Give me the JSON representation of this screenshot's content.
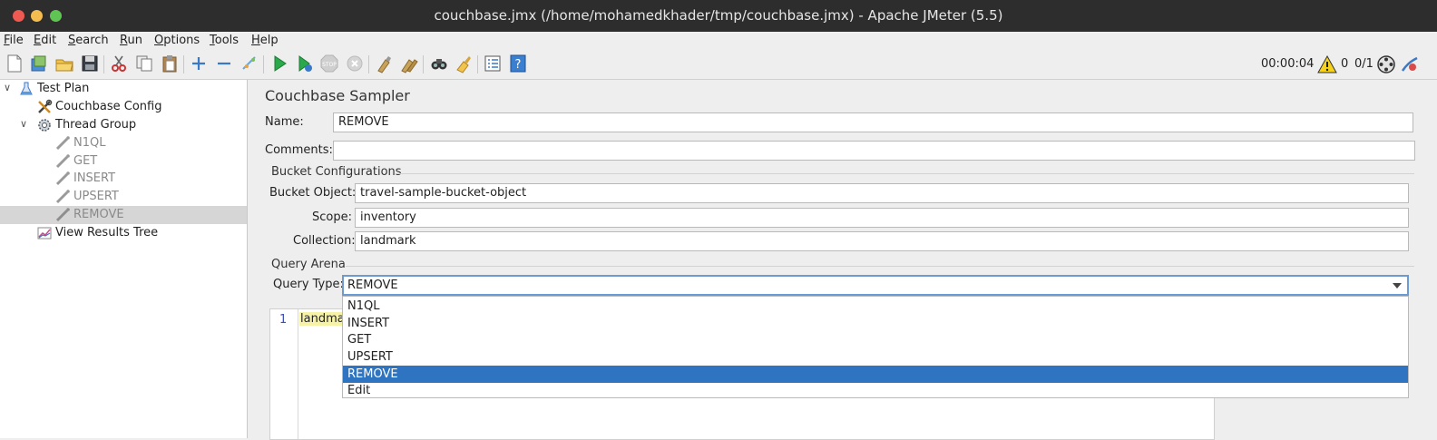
{
  "window": {
    "title": "couchbase.jmx (/home/mohamedkhader/tmp/couchbase.jmx) - Apache JMeter (5.5)",
    "traffic_lights": [
      "#ee5a52",
      "#f5bd4f",
      "#5fc454"
    ]
  },
  "menu": {
    "items": [
      {
        "mnemonic": "F",
        "rest": "ile"
      },
      {
        "mnemonic": "E",
        "rest": "dit"
      },
      {
        "mnemonic": "S",
        "rest": "earch"
      },
      {
        "mnemonic": "R",
        "rest": "un"
      },
      {
        "mnemonic": "O",
        "rest": "ptions"
      },
      {
        "mnemonic": "T",
        "rest": "ools"
      },
      {
        "mnemonic": "H",
        "rest": "elp"
      }
    ]
  },
  "toolbar": {
    "elapsed_time": "00:00:04",
    "warning_count": "0",
    "threads": "0/1"
  },
  "tree": {
    "nodes": [
      {
        "label": "Test Plan",
        "icon": "flask-icon",
        "expanded": true
      },
      {
        "label": "Couchbase Config",
        "icon": "wrench-screwdriver-icon"
      },
      {
        "label": "Thread Group",
        "icon": "gear-icon",
        "expanded": true
      },
      {
        "label": "N1QL",
        "icon": "pipette-icon",
        "disabled": true
      },
      {
        "label": "GET",
        "icon": "pipette-icon",
        "disabled": true
      },
      {
        "label": "INSERT",
        "icon": "pipette-icon",
        "disabled": true
      },
      {
        "label": "UPSERT",
        "icon": "pipette-icon",
        "disabled": true
      },
      {
        "label": "REMOVE",
        "icon": "pipette-icon",
        "disabled": true,
        "selected": true
      },
      {
        "label": "View Results Tree",
        "icon": "chart-icon"
      }
    ]
  },
  "panel": {
    "heading": "Couchbase Sampler",
    "name_label": "Name:",
    "name_value": "REMOVE",
    "comments_label": "Comments:",
    "comments_value": "",
    "bucket_group": "Bucket Configurations",
    "bucket_object_label": "Bucket Object:",
    "bucket_object_value": "travel-sample-bucket-object",
    "scope_label": "Scope:",
    "scope_value": "inventory",
    "collection_label": "Collection:",
    "collection_value": "landmark",
    "query_group": "Query Arena",
    "query_type_label": "Query Type:",
    "query_type_value": "REMOVE",
    "editor_line_number": "1",
    "editor_text": "landma",
    "query_type_options": [
      "N1QL",
      "INSERT",
      "GET",
      "UPSERT",
      "REMOVE",
      "Edit"
    ],
    "selected_option_index": 4
  }
}
